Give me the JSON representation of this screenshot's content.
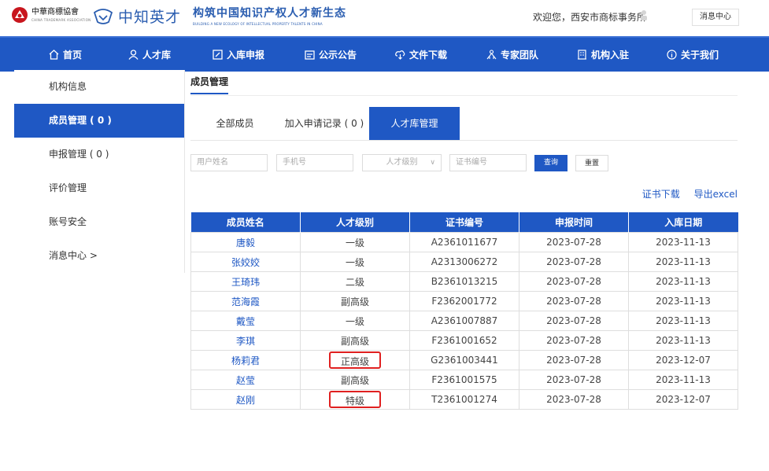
{
  "header": {
    "org_name": "中華商標協會",
    "org_sub": "CHINA TRADEMARK ASSOCIATION",
    "brand_name": "中知英才",
    "slogan": "构筑中国知识产权人才新生态",
    "slogan_en": "BUILDING A NEW ECOLOGY OF INTELLECTUAL PROPERTY TALENTS IN CHINA",
    "welcome_text": "欢迎您，西安市商标事务所",
    "message_center_label": "消息中心"
  },
  "nav": [
    {
      "label": "首页",
      "icon": "home-icon"
    },
    {
      "label": "人才库",
      "icon": "person-icon"
    },
    {
      "label": "入库申报",
      "icon": "edit-icon"
    },
    {
      "label": "公示公告",
      "icon": "notice-icon"
    },
    {
      "label": "文件下载",
      "icon": "download-icon"
    },
    {
      "label": "专家团队",
      "icon": "team-icon"
    },
    {
      "label": "机构入驻",
      "icon": "building-icon"
    },
    {
      "label": "关于我们",
      "icon": "info-icon"
    }
  ],
  "sidebar": {
    "items": [
      {
        "label": "机构信息"
      },
      {
        "label": "成员管理 ( 0 )"
      },
      {
        "label": "申报管理 ( 0 )"
      },
      {
        "label": "评价管理"
      },
      {
        "label": "账号安全"
      },
      {
        "label": "消息中心  >"
      }
    ]
  },
  "main": {
    "title": "成员管理",
    "tabs": [
      {
        "label": "全部成员"
      },
      {
        "label": "加入申请记录 ( 0 )"
      },
      {
        "label": "人才库管理"
      }
    ],
    "filters": {
      "name_placeholder": "用户姓名",
      "phone_placeholder": "手机号",
      "level_placeholder": "人才级别",
      "cert_placeholder": "证书编号",
      "search_label": "查询",
      "reset_label": "重置"
    },
    "links": {
      "cert_download": "证书下载",
      "export_excel": "导出excel"
    },
    "table": {
      "columns": [
        "成员姓名",
        "人才级别",
        "证书编号",
        "申报时间",
        "入库日期"
      ],
      "rows": [
        {
          "name": "唐毅",
          "level": "一级",
          "cert": "A2361011677",
          "apply": "2023-07-28",
          "entry": "2023-11-13",
          "highlight": false
        },
        {
          "name": "张姣姣",
          "level": "一级",
          "cert": "A2313006272",
          "apply": "2023-07-28",
          "entry": "2023-11-13",
          "highlight": false
        },
        {
          "name": "王琦玮",
          "level": "二级",
          "cert": "B2361013215",
          "apply": "2023-07-28",
          "entry": "2023-11-13",
          "highlight": false
        },
        {
          "name": "范海霞",
          "level": "副高级",
          "cert": "F2362001772",
          "apply": "2023-07-28",
          "entry": "2023-11-13",
          "highlight": false
        },
        {
          "name": "戴莹",
          "level": "一级",
          "cert": "A2361007887",
          "apply": "2023-07-28",
          "entry": "2023-11-13",
          "highlight": false
        },
        {
          "name": "李琪",
          "level": "副高级",
          "cert": "F2361001652",
          "apply": "2023-07-28",
          "entry": "2023-11-13",
          "highlight": false
        },
        {
          "name": "杨莉君",
          "level": "正高级",
          "cert": "G2361003441",
          "apply": "2023-07-28",
          "entry": "2023-12-07",
          "highlight": true
        },
        {
          "name": "赵莹",
          "level": "副高级",
          "cert": "F2361001575",
          "apply": "2023-07-28",
          "entry": "2023-11-13",
          "highlight": false
        },
        {
          "name": "赵刚",
          "level": "特级",
          "cert": "T2361001274",
          "apply": "2023-07-28",
          "entry": "2023-12-07",
          "highlight": true
        }
      ]
    }
  },
  "colors": {
    "primary": "#1f58c4",
    "highlight_border": "#e02020",
    "seal_red": "#c8161d"
  }
}
